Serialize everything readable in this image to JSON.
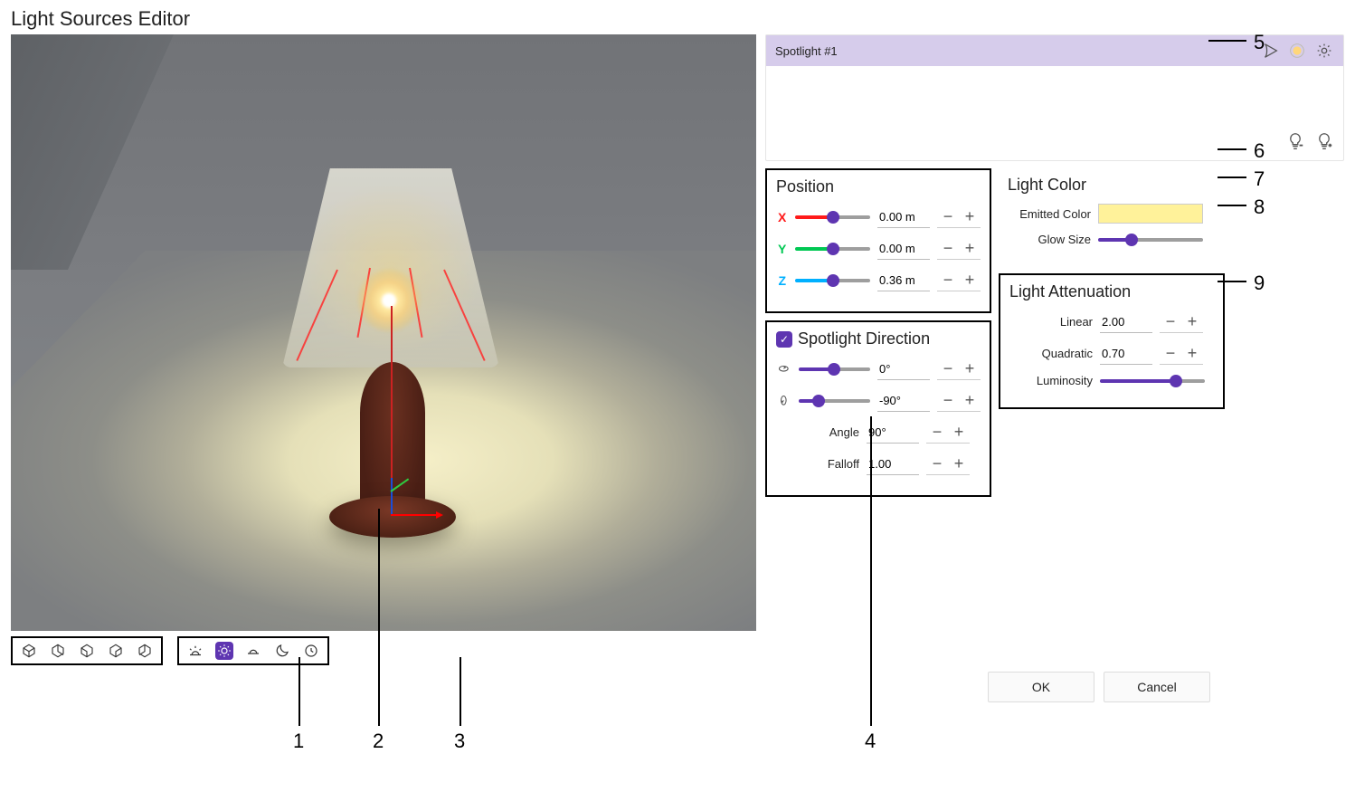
{
  "title": "Light Sources Editor",
  "lightList": {
    "selected": "Spotlight #1"
  },
  "position": {
    "title": "Position",
    "x": {
      "label": "X",
      "value": "0.00 m",
      "ratio": 0.5,
      "color": "#ff1a1a"
    },
    "y": {
      "label": "Y",
      "value": "0.00 m",
      "ratio": 0.5,
      "color": "#00c853"
    },
    "z": {
      "label": "Z",
      "value": "0.36 m",
      "ratio": 0.5,
      "color": "#00b0ff"
    }
  },
  "spotlight": {
    "title": "Spotlight Direction",
    "rotH": {
      "value": "0°",
      "ratio": 0.5
    },
    "rotV": {
      "value": "-90°",
      "ratio": 0.28
    },
    "angle": {
      "label": "Angle",
      "value": "90°"
    },
    "falloff": {
      "label": "Falloff",
      "value": "1.00"
    }
  },
  "lightColor": {
    "title": "Light Color",
    "emitted": {
      "label": "Emitted Color",
      "hex": "#fff29a"
    },
    "glowSize": {
      "label": "Glow Size",
      "ratio": 0.32
    }
  },
  "attenuation": {
    "title": "Light Attenuation",
    "linear": {
      "label": "Linear",
      "value": "2.00"
    },
    "quadratic": {
      "label": "Quadratic",
      "value": "0.70"
    },
    "luminosity": {
      "label": "Luminosity",
      "ratio": 0.72
    }
  },
  "buttons": {
    "ok": "OK",
    "cancel": "Cancel"
  },
  "callouts": {
    "1": "1",
    "2": "2",
    "3": "3",
    "4": "4",
    "5": "5",
    "6": "6",
    "7": "7",
    "8": "8",
    "9": "9"
  }
}
